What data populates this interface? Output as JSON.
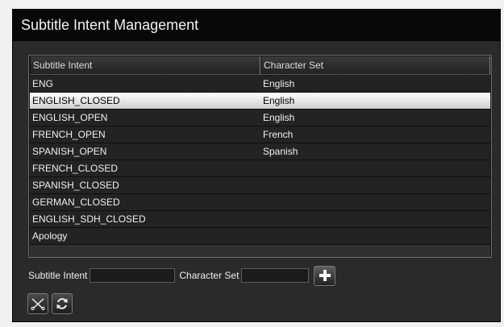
{
  "dialog": {
    "title": "Subtitle Intent Management"
  },
  "table": {
    "columns": [
      "Subtitle Intent",
      "Character Set"
    ],
    "rows": [
      {
        "intent": "ENG",
        "charset": "English",
        "selected": false
      },
      {
        "intent": "ENGLISH_CLOSED",
        "charset": "English",
        "selected": true
      },
      {
        "intent": "ENGLISH_OPEN",
        "charset": "English",
        "selected": false
      },
      {
        "intent": "FRENCH_OPEN",
        "charset": "French",
        "selected": false
      },
      {
        "intent": "SPANISH_OPEN",
        "charset": "Spanish",
        "selected": false
      },
      {
        "intent": "FRENCH_CLOSED",
        "charset": "",
        "selected": false
      },
      {
        "intent": "SPANISH_CLOSED",
        "charset": "",
        "selected": false
      },
      {
        "intent": "GERMAN_CLOSED",
        "charset": "",
        "selected": false
      },
      {
        "intent": "ENGLISH_SDH_CLOSED",
        "charset": "",
        "selected": false
      },
      {
        "intent": "Apology",
        "charset": "",
        "selected": false
      }
    ]
  },
  "form": {
    "intent_label": "Subtitle Intent",
    "intent_value": "",
    "charset_label": "Character Set",
    "charset_value": ""
  },
  "icons": {
    "add": "plus-icon",
    "delete": "scissors-icon",
    "refresh": "refresh-icon"
  },
  "colors": {
    "dialog_bg": "#2a2a2a",
    "titlebar_bg": "#080808",
    "selected_row": "#ffffff"
  }
}
